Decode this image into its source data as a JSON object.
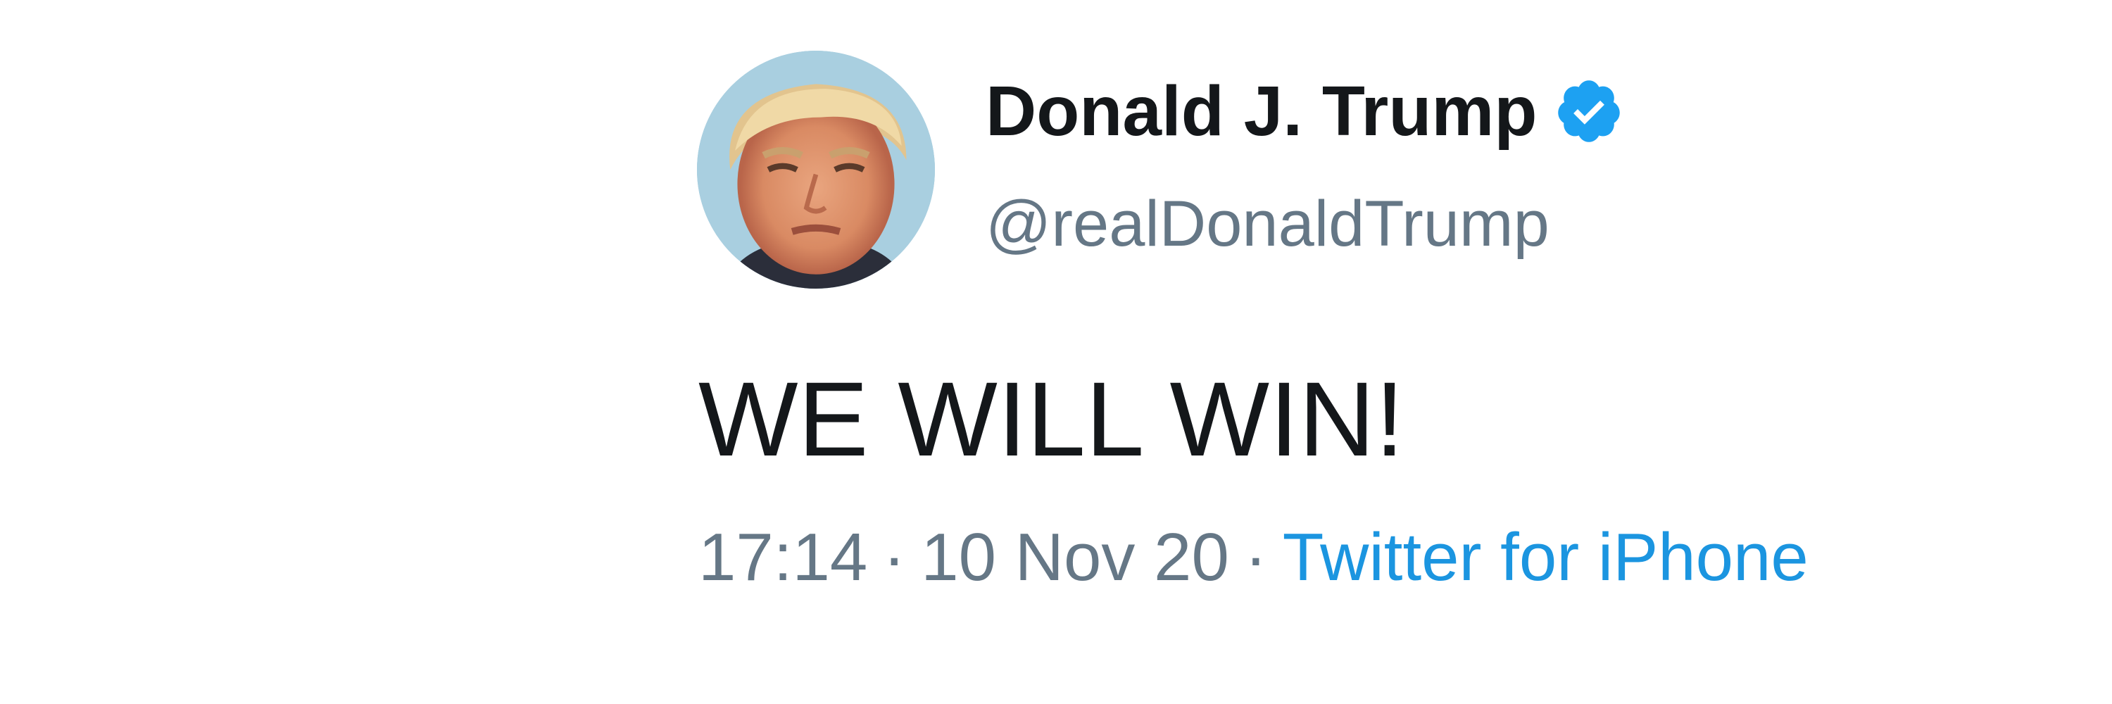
{
  "tweet": {
    "author": {
      "display_name": "Donald J. Trump",
      "handle": "@realDonaldTrump",
      "verified": true,
      "avatar_icon": "profile-photo"
    },
    "text": "WE WILL WIN!",
    "meta": {
      "time": "17:14",
      "separator": "·",
      "date": "10 Nov 20",
      "source": "Twitter for iPhone"
    }
  },
  "colors": {
    "name": "#14171a",
    "secondary": "#657786",
    "link": "#1b95e0",
    "verified_badge": "#1da1f2",
    "background": "#ffffff"
  }
}
